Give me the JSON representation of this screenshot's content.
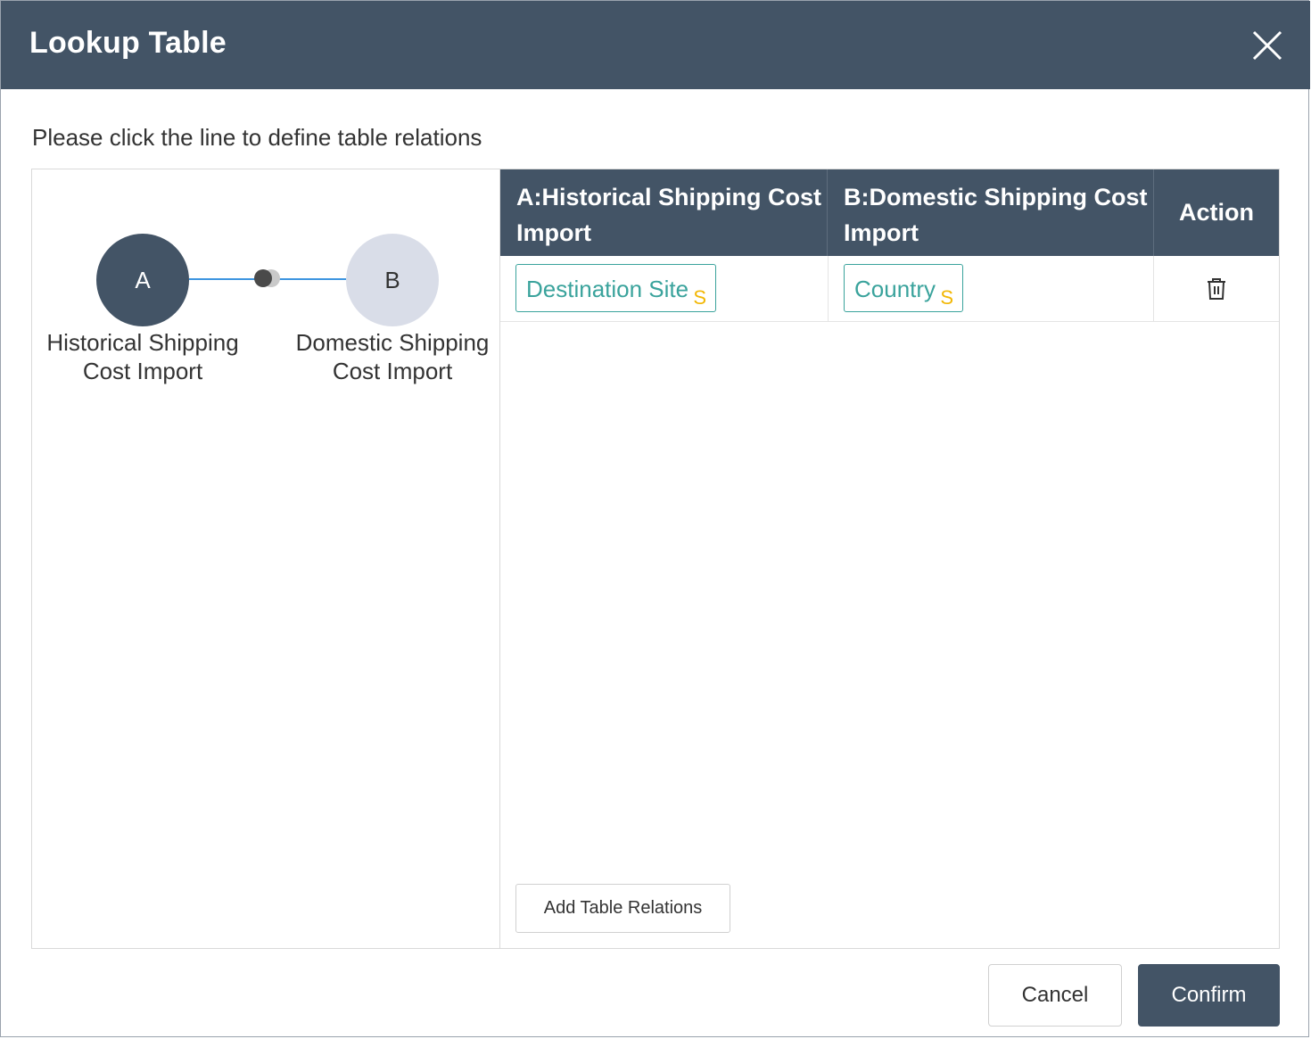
{
  "dialog": {
    "title": "Lookup Table",
    "close_icon": "close-icon"
  },
  "instruction": "Please click the line to define table relations",
  "graph": {
    "node_a": {
      "letter": "A",
      "label": "Historical Shipping Cost Import",
      "color": "#435466"
    },
    "node_b": {
      "letter": "B",
      "label": "Domestic Shipping Cost Import",
      "color": "#d9dde8"
    },
    "link_color": "#3d95e0"
  },
  "table": {
    "headers": {
      "a": "A:Historical Shipping Cost Import",
      "b": "B:Domestic Shipping Cost Import",
      "action": "Action"
    },
    "rows": [
      {
        "a_field": "Destination Site",
        "a_type": "S",
        "b_field": "Country",
        "b_type": "S",
        "action_icon": "trash-icon"
      }
    ],
    "add_button": "Add Table Relations"
  },
  "footer": {
    "cancel": "Cancel",
    "confirm": "Confirm"
  },
  "colors": {
    "header_bg": "#435466",
    "field_accent": "#3aa39c",
    "type_badge": "#f2b705"
  }
}
